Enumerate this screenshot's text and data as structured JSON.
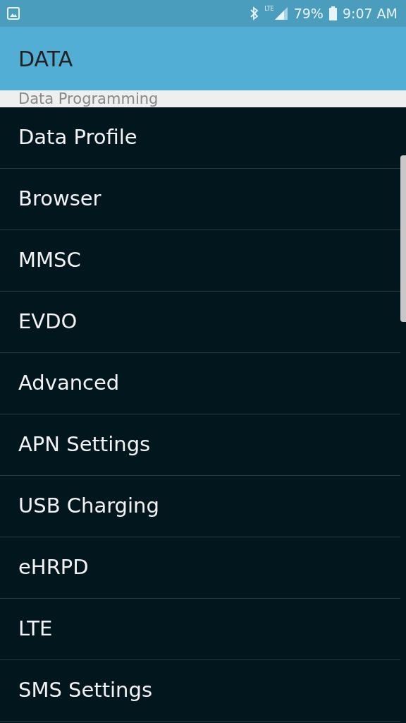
{
  "status_bar": {
    "network": "LTE",
    "battery": "79%",
    "time": "9:07 AM"
  },
  "app_bar": {
    "title": "DATA"
  },
  "section": {
    "title": "Data Programming"
  },
  "items": [
    {
      "label": "Data Profile"
    },
    {
      "label": "Browser"
    },
    {
      "label": "MMSC"
    },
    {
      "label": "EVDO"
    },
    {
      "label": "Advanced"
    },
    {
      "label": "APN Settings"
    },
    {
      "label": "USB Charging"
    },
    {
      "label": "eHRPD"
    },
    {
      "label": "LTE"
    },
    {
      "label": "SMS Settings"
    }
  ]
}
